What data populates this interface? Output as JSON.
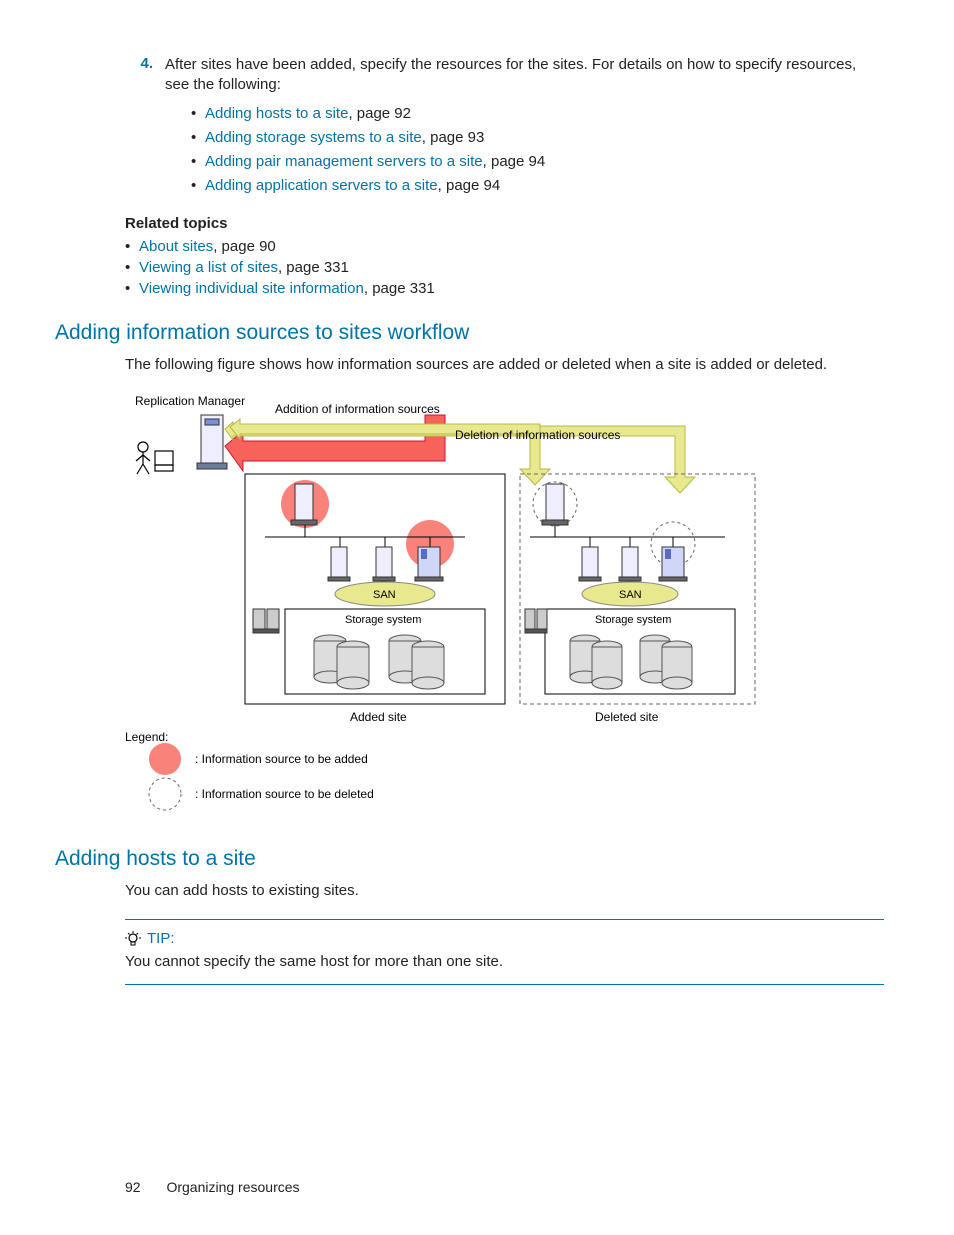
{
  "step4": {
    "num": "4.",
    "text_a": "After sites have been added, specify the resources for the sites. For details on how to specify resources, see the following:",
    "bullets": [
      {
        "link": "Adding hosts to a site",
        "suffix": ", page 92"
      },
      {
        "link": "Adding storage systems to a site",
        "suffix": ", page 93"
      },
      {
        "link": "Adding pair management servers to a site",
        "suffix": ", page 94"
      },
      {
        "link": "Adding application servers to a site",
        "suffix": ", page 94"
      }
    ]
  },
  "related": {
    "heading": "Related topics",
    "items": [
      {
        "link": "About sites",
        "suffix": ", page 90"
      },
      {
        "link": "Viewing a list of sites",
        "suffix": ", page 331"
      },
      {
        "link": "Viewing individual site information",
        "suffix": ", page 331"
      }
    ]
  },
  "section1": {
    "heading": "Adding information sources to sites workflow",
    "para": "The following figure shows how information sources are added or deleted when a site is added or deleted."
  },
  "diagram": {
    "rep_mgr": "Replication Manager",
    "addition": "Addition of information sources",
    "deletion": "Deletion of information sources",
    "san": "SAN",
    "storage": "Storage system",
    "added_site": "Added site",
    "deleted_site": "Deleted site",
    "legend": "Legend:",
    "legend_add": ": Information source to be added",
    "legend_del": ": Information source to be deleted"
  },
  "section2": {
    "heading": "Adding hosts to a site",
    "para": "You can add hosts to existing sites."
  },
  "tip": {
    "label": "TIP:",
    "text": "You cannot specify the same host for more than one site."
  },
  "footer": {
    "page": "92",
    "title": "Organizing resources"
  }
}
